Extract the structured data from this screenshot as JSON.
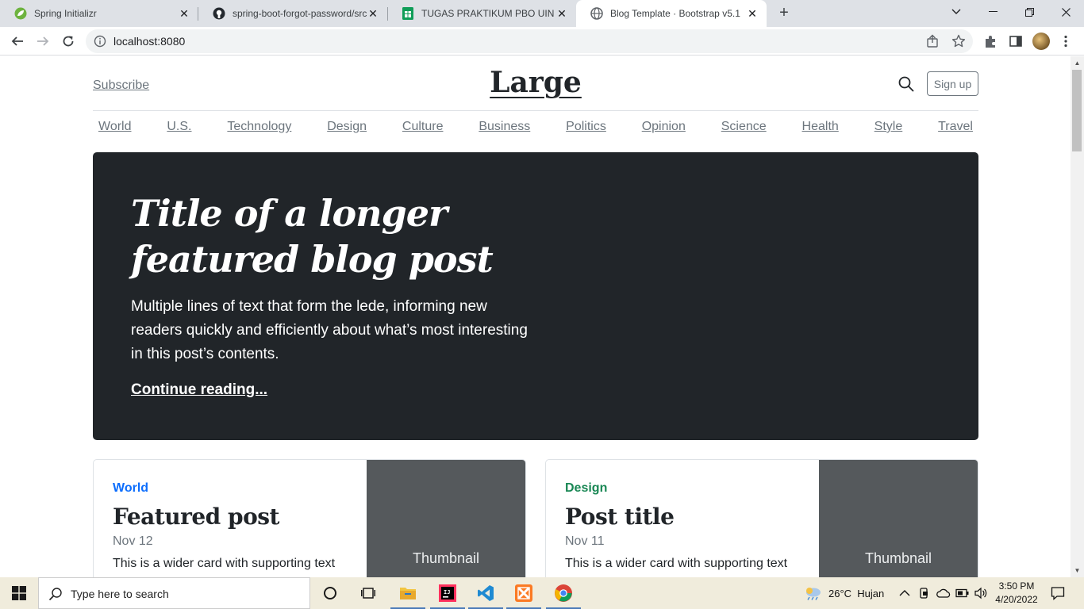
{
  "browser": {
    "tabs": [
      {
        "title": "Spring Initializr",
        "icon": "spring-leaf-icon"
      },
      {
        "title": "spring-boot-forgot-password/src",
        "icon": "github-icon"
      },
      {
        "title": "TUGAS PRAKTIKUM PBO UIN SGD",
        "icon": "sheets-icon"
      },
      {
        "title": "Blog Template · Bootstrap v5.1",
        "icon": "globe-icon"
      }
    ],
    "active_tab": 3,
    "url": "localhost:8080"
  },
  "page": {
    "subscribe": "Subscribe",
    "logo": "Large",
    "signup": "Sign up",
    "categories": [
      "World",
      "U.S.",
      "Technology",
      "Design",
      "Culture",
      "Business",
      "Politics",
      "Opinion",
      "Science",
      "Health",
      "Style",
      "Travel"
    ],
    "hero": {
      "title": "Title of a longer featured blog post",
      "lede": "Multiple lines of text that form the lede, informing new readers quickly and efficiently about what’s most interesting in this post’s contents.",
      "link": "Continue reading..."
    },
    "cards": [
      {
        "category": "World",
        "category_color": "#0d6efd",
        "title": "Featured post",
        "date": "Nov 12",
        "text": "This is a wider card with supporting text",
        "thumb": "Thumbnail"
      },
      {
        "category": "Design",
        "category_color": "#198754",
        "title": "Post title",
        "date": "Nov 11",
        "text": "This is a wider card with supporting text",
        "thumb": "Thumbnail"
      }
    ]
  },
  "taskbar": {
    "search_placeholder": "Type here to search",
    "weather": "26°C  Hujan",
    "time": "3:50 PM",
    "date": "4/20/2022"
  }
}
